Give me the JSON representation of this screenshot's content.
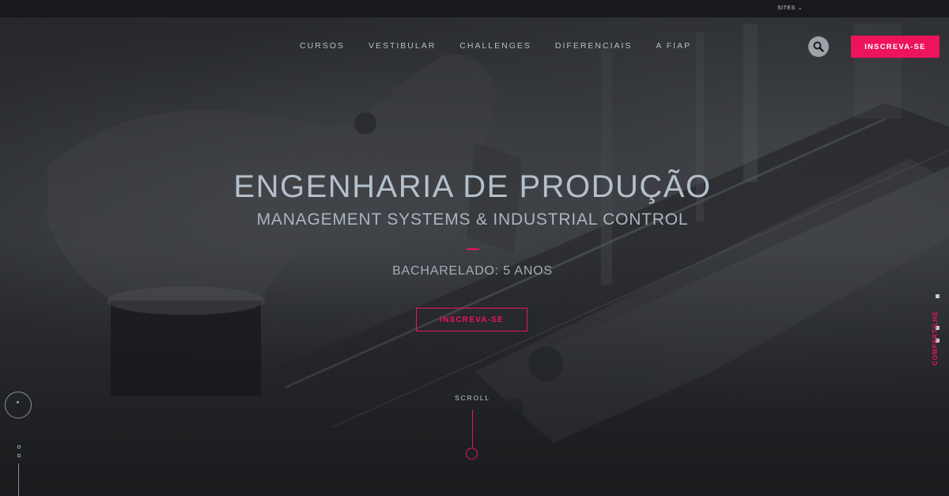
{
  "topbar": {
    "sites_label": "SITES"
  },
  "nav": {
    "items": [
      {
        "label": "CURSOS"
      },
      {
        "label": "VESTIBULAR"
      },
      {
        "label": "CHALLENGES"
      },
      {
        "label": "DIFERENCIAIS"
      },
      {
        "label": "A FIAP"
      }
    ],
    "search_icon": "search-icon",
    "cta_label": "INSCREVA-SE"
  },
  "hero": {
    "title": "ENGENHARIA DE PRODUÇÃO",
    "subtitle": "MANAGEMENT SYSTEMS & INDUSTRIAL CONTROL",
    "duration": "BACHARELADO: 5 ANOS",
    "cta_label": "INSCREVA-SE",
    "scroll_label": "SCROLL"
  },
  "share": {
    "label": "COMPARTILHE"
  },
  "colors": {
    "accent": "#ed145b",
    "title_text": "#b4c0cb",
    "topbar_bg": "#17191c"
  }
}
